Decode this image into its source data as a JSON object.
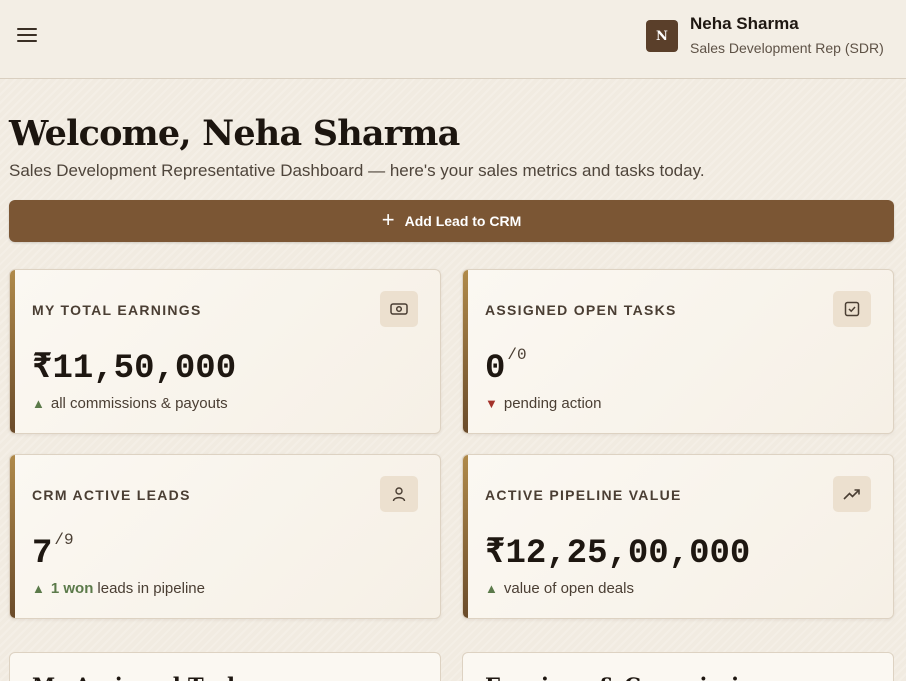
{
  "header": {
    "avatar_initial": "N",
    "user_name": "Neha Sharma",
    "user_role": "Sales Development Rep (SDR)"
  },
  "welcome": {
    "title": "Welcome, Neha Sharma",
    "subtitle": "Sales Development Representative Dashboard — here's your sales metrics and tasks today."
  },
  "actions": {
    "add_lead_label": "Add Lead to CRM"
  },
  "cards": [
    {
      "label": "MY TOTAL EARNINGS",
      "icon": "money-icon",
      "value": "₹11,50,000",
      "denominator": "",
      "trend": "up",
      "highlight": "",
      "foot": "all commissions & payouts"
    },
    {
      "label": "ASSIGNED OPEN TASKS",
      "icon": "checkbox-icon",
      "value": "0",
      "denominator": "/0",
      "trend": "down",
      "highlight": "",
      "foot": "pending action"
    },
    {
      "label": "CRM ACTIVE LEADS",
      "icon": "user-icon",
      "value": "7",
      "denominator": "/9",
      "trend": "up",
      "highlight": "1 won",
      "foot": "leads in pipeline"
    },
    {
      "label": "ACTIVE PIPELINE VALUE",
      "icon": "trending-up-icon",
      "value": "₹12,25,00,000",
      "denominator": "",
      "trend": "up",
      "highlight": "",
      "foot": "value of open deals"
    }
  ],
  "sections": {
    "tasks_title": "My Assigned Tasks",
    "earnings_title": "Earnings & Commissions"
  },
  "colors": {
    "accent": "#7b5634",
    "avatar": "#5a3f2a",
    "trend_up": "#5b7a4a",
    "trend_down": "#a3322a"
  }
}
